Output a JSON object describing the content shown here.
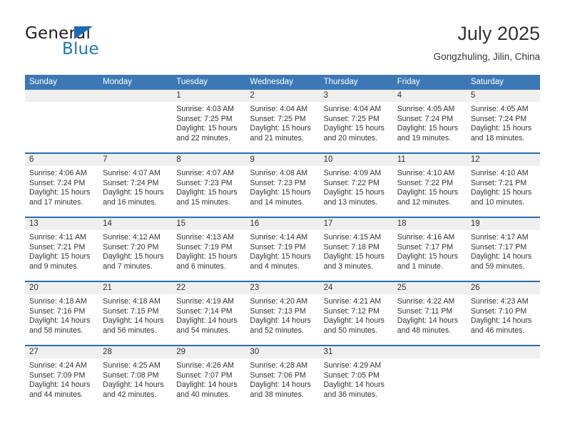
{
  "brand": {
    "word_one": "General",
    "word_two": "Blue",
    "triangle_icon": "brand-triangle-icon",
    "accent_dark": "#1b6cb4",
    "accent_blue": "#1878be"
  },
  "header": {
    "title": "July 2025",
    "subtitle": "Gongzhuling, Jilin, China"
  },
  "theme": {
    "header_blue": "#3c78b5",
    "row_border_blue": "#2e6da8",
    "day_band_gray": "#efefef",
    "text": "#333333"
  },
  "weekdays": [
    "Sunday",
    "Monday",
    "Tuesday",
    "Wednesday",
    "Thursday",
    "Friday",
    "Saturday"
  ],
  "weeks": [
    [
      {
        "day": "",
        "sunrise": "",
        "sunset": "",
        "daylight_line1": "",
        "daylight_line2": "",
        "empty": true
      },
      {
        "day": "",
        "sunrise": "",
        "sunset": "",
        "daylight_line1": "",
        "daylight_line2": "",
        "empty": true
      },
      {
        "day": "1",
        "sunrise": "Sunrise: 4:03 AM",
        "sunset": "Sunset: 7:25 PM",
        "daylight_line1": "Daylight: 15 hours",
        "daylight_line2": "and 22 minutes."
      },
      {
        "day": "2",
        "sunrise": "Sunrise: 4:04 AM",
        "sunset": "Sunset: 7:25 PM",
        "daylight_line1": "Daylight: 15 hours",
        "daylight_line2": "and 21 minutes."
      },
      {
        "day": "3",
        "sunrise": "Sunrise: 4:04 AM",
        "sunset": "Sunset: 7:25 PM",
        "daylight_line1": "Daylight: 15 hours",
        "daylight_line2": "and 20 minutes."
      },
      {
        "day": "4",
        "sunrise": "Sunrise: 4:05 AM",
        "sunset": "Sunset: 7:24 PM",
        "daylight_line1": "Daylight: 15 hours",
        "daylight_line2": "and 19 minutes."
      },
      {
        "day": "5",
        "sunrise": "Sunrise: 4:05 AM",
        "sunset": "Sunset: 7:24 PM",
        "daylight_line1": "Daylight: 15 hours",
        "daylight_line2": "and 18 minutes."
      }
    ],
    [
      {
        "day": "6",
        "sunrise": "Sunrise: 4:06 AM",
        "sunset": "Sunset: 7:24 PM",
        "daylight_line1": "Daylight: 15 hours",
        "daylight_line2": "and 17 minutes."
      },
      {
        "day": "7",
        "sunrise": "Sunrise: 4:07 AM",
        "sunset": "Sunset: 7:24 PM",
        "daylight_line1": "Daylight: 15 hours",
        "daylight_line2": "and 16 minutes."
      },
      {
        "day": "8",
        "sunrise": "Sunrise: 4:07 AM",
        "sunset": "Sunset: 7:23 PM",
        "daylight_line1": "Daylight: 15 hours",
        "daylight_line2": "and 15 minutes."
      },
      {
        "day": "9",
        "sunrise": "Sunrise: 4:08 AM",
        "sunset": "Sunset: 7:23 PM",
        "daylight_line1": "Daylight: 15 hours",
        "daylight_line2": "and 14 minutes."
      },
      {
        "day": "10",
        "sunrise": "Sunrise: 4:09 AM",
        "sunset": "Sunset: 7:22 PM",
        "daylight_line1": "Daylight: 15 hours",
        "daylight_line2": "and 13 minutes."
      },
      {
        "day": "11",
        "sunrise": "Sunrise: 4:10 AM",
        "sunset": "Sunset: 7:22 PM",
        "daylight_line1": "Daylight: 15 hours",
        "daylight_line2": "and 12 minutes."
      },
      {
        "day": "12",
        "sunrise": "Sunrise: 4:10 AM",
        "sunset": "Sunset: 7:21 PM",
        "daylight_line1": "Daylight: 15 hours",
        "daylight_line2": "and 10 minutes."
      }
    ],
    [
      {
        "day": "13",
        "sunrise": "Sunrise: 4:11 AM",
        "sunset": "Sunset: 7:21 PM",
        "daylight_line1": "Daylight: 15 hours",
        "daylight_line2": "and 9 minutes."
      },
      {
        "day": "14",
        "sunrise": "Sunrise: 4:12 AM",
        "sunset": "Sunset: 7:20 PM",
        "daylight_line1": "Daylight: 15 hours",
        "daylight_line2": "and 7 minutes."
      },
      {
        "day": "15",
        "sunrise": "Sunrise: 4:13 AM",
        "sunset": "Sunset: 7:19 PM",
        "daylight_line1": "Daylight: 15 hours",
        "daylight_line2": "and 6 minutes."
      },
      {
        "day": "16",
        "sunrise": "Sunrise: 4:14 AM",
        "sunset": "Sunset: 7:19 PM",
        "daylight_line1": "Daylight: 15 hours",
        "daylight_line2": "and 4 minutes."
      },
      {
        "day": "17",
        "sunrise": "Sunrise: 4:15 AM",
        "sunset": "Sunset: 7:18 PM",
        "daylight_line1": "Daylight: 15 hours",
        "daylight_line2": "and 3 minutes."
      },
      {
        "day": "18",
        "sunrise": "Sunrise: 4:16 AM",
        "sunset": "Sunset: 7:17 PM",
        "daylight_line1": "Daylight: 15 hours",
        "daylight_line2": "and 1 minute."
      },
      {
        "day": "19",
        "sunrise": "Sunrise: 4:17 AM",
        "sunset": "Sunset: 7:17 PM",
        "daylight_line1": "Daylight: 14 hours",
        "daylight_line2": "and 59 minutes."
      }
    ],
    [
      {
        "day": "20",
        "sunrise": "Sunrise: 4:18 AM",
        "sunset": "Sunset: 7:16 PM",
        "daylight_line1": "Daylight: 14 hours",
        "daylight_line2": "and 58 minutes."
      },
      {
        "day": "21",
        "sunrise": "Sunrise: 4:18 AM",
        "sunset": "Sunset: 7:15 PM",
        "daylight_line1": "Daylight: 14 hours",
        "daylight_line2": "and 56 minutes."
      },
      {
        "day": "22",
        "sunrise": "Sunrise: 4:19 AM",
        "sunset": "Sunset: 7:14 PM",
        "daylight_line1": "Daylight: 14 hours",
        "daylight_line2": "and 54 minutes."
      },
      {
        "day": "23",
        "sunrise": "Sunrise: 4:20 AM",
        "sunset": "Sunset: 7:13 PM",
        "daylight_line1": "Daylight: 14 hours",
        "daylight_line2": "and 52 minutes."
      },
      {
        "day": "24",
        "sunrise": "Sunrise: 4:21 AM",
        "sunset": "Sunset: 7:12 PM",
        "daylight_line1": "Daylight: 14 hours",
        "daylight_line2": "and 50 minutes."
      },
      {
        "day": "25",
        "sunrise": "Sunrise: 4:22 AM",
        "sunset": "Sunset: 7:11 PM",
        "daylight_line1": "Daylight: 14 hours",
        "daylight_line2": "and 48 minutes."
      },
      {
        "day": "26",
        "sunrise": "Sunrise: 4:23 AM",
        "sunset": "Sunset: 7:10 PM",
        "daylight_line1": "Daylight: 14 hours",
        "daylight_line2": "and 46 minutes."
      }
    ],
    [
      {
        "day": "27",
        "sunrise": "Sunrise: 4:24 AM",
        "sunset": "Sunset: 7:09 PM",
        "daylight_line1": "Daylight: 14 hours",
        "daylight_line2": "and 44 minutes."
      },
      {
        "day": "28",
        "sunrise": "Sunrise: 4:25 AM",
        "sunset": "Sunset: 7:08 PM",
        "daylight_line1": "Daylight: 14 hours",
        "daylight_line2": "and 42 minutes."
      },
      {
        "day": "29",
        "sunrise": "Sunrise: 4:26 AM",
        "sunset": "Sunset: 7:07 PM",
        "daylight_line1": "Daylight: 14 hours",
        "daylight_line2": "and 40 minutes."
      },
      {
        "day": "30",
        "sunrise": "Sunrise: 4:28 AM",
        "sunset": "Sunset: 7:06 PM",
        "daylight_line1": "Daylight: 14 hours",
        "daylight_line2": "and 38 minutes."
      },
      {
        "day": "31",
        "sunrise": "Sunrise: 4:29 AM",
        "sunset": "Sunset: 7:05 PM",
        "daylight_line1": "Daylight: 14 hours",
        "daylight_line2": "and 36 minutes."
      },
      {
        "day": "",
        "sunrise": "",
        "sunset": "",
        "daylight_line1": "",
        "daylight_line2": "",
        "empty": true
      },
      {
        "day": "",
        "sunrise": "",
        "sunset": "",
        "daylight_line1": "",
        "daylight_line2": "",
        "empty": true
      }
    ]
  ]
}
